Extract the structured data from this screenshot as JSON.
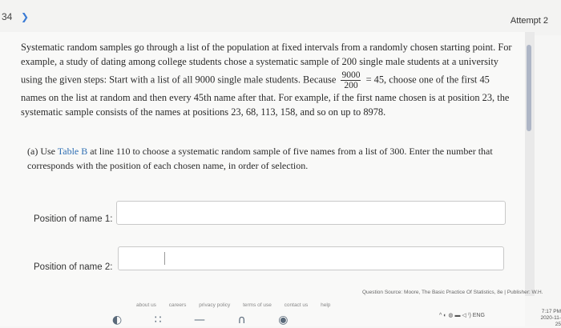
{
  "header": {
    "question_number": "34",
    "attempt_label": "Attempt 2"
  },
  "intro": {
    "line1": "Systematic random samples go through a list of the population at fixed intervals from a randomly chosen starting point. For",
    "line2": "example, a study of dating among college students chose a systematic sample of 200 single male students at a university",
    "line3_before": "using the given steps: Start with a list of all 9000 single male students. Because",
    "frac_num": "9000",
    "frac_den": "200",
    "line3_after": "= 45, choose one of the first 45",
    "line4": "names on the list at random and then every 45th name after that. For example, if the first name chosen is at position 23, the",
    "line5": "systematic sample consists of the names at positions 23, 68, 113, 158, and so on up to 8978."
  },
  "part_a": {
    "before": "(a) Use",
    "link": "Table B",
    "after": "at line 110 to choose a systematic random sample of five names from a list of 300. Enter the number that",
    "line2": "corresponds with the position of each chosen name, in order of selection."
  },
  "fields": {
    "name1_label": "Position of name 1:",
    "name1_value": "",
    "name2_label": "Position of name 2:",
    "name2_value": ""
  },
  "source": {
    "text": "Question Source: Moore, The Basic Practice Of Statistics, 8e  |  Publisher: W.H."
  },
  "footer": {
    "links": [
      "about us",
      "careers",
      "privacy policy",
      "terms of use",
      "contact us",
      "help"
    ]
  },
  "taskbar": {
    "tray_text": "^ ◐ ◍ ▬ ◁ ⁾) ENG",
    "time": "7:17 PM",
    "date": "2020-11-25"
  }
}
